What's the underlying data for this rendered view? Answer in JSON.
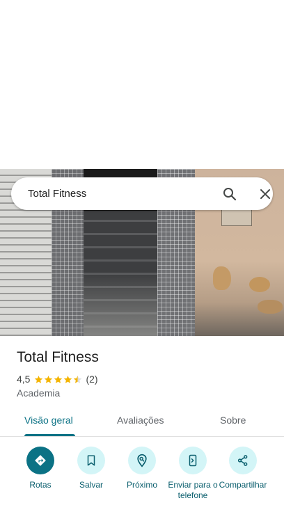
{
  "search": {
    "query": "Total Fitness"
  },
  "place": {
    "title": "Total Fitness",
    "rating": "4,5",
    "rating_value": 4.5,
    "reviews": "(2)",
    "category": "Academia"
  },
  "tabs": [
    {
      "label": "Visão geral",
      "active": true
    },
    {
      "label": "Avaliações",
      "active": false
    },
    {
      "label": "Sobre",
      "active": false
    }
  ],
  "actions": [
    {
      "label": "Rotas",
      "icon": "directions-icon"
    },
    {
      "label": "Salvar",
      "icon": "bookmark-icon"
    },
    {
      "label": "Próximo",
      "icon": "nearby-icon"
    },
    {
      "label": "Enviar para o telefone",
      "icon": "send-to-phone-icon"
    },
    {
      "label": "Compartilhar",
      "icon": "share-icon"
    }
  ],
  "colors": {
    "accent": "#0b7285",
    "action_bg": "#d3f5f7",
    "star": "#f4b400"
  }
}
